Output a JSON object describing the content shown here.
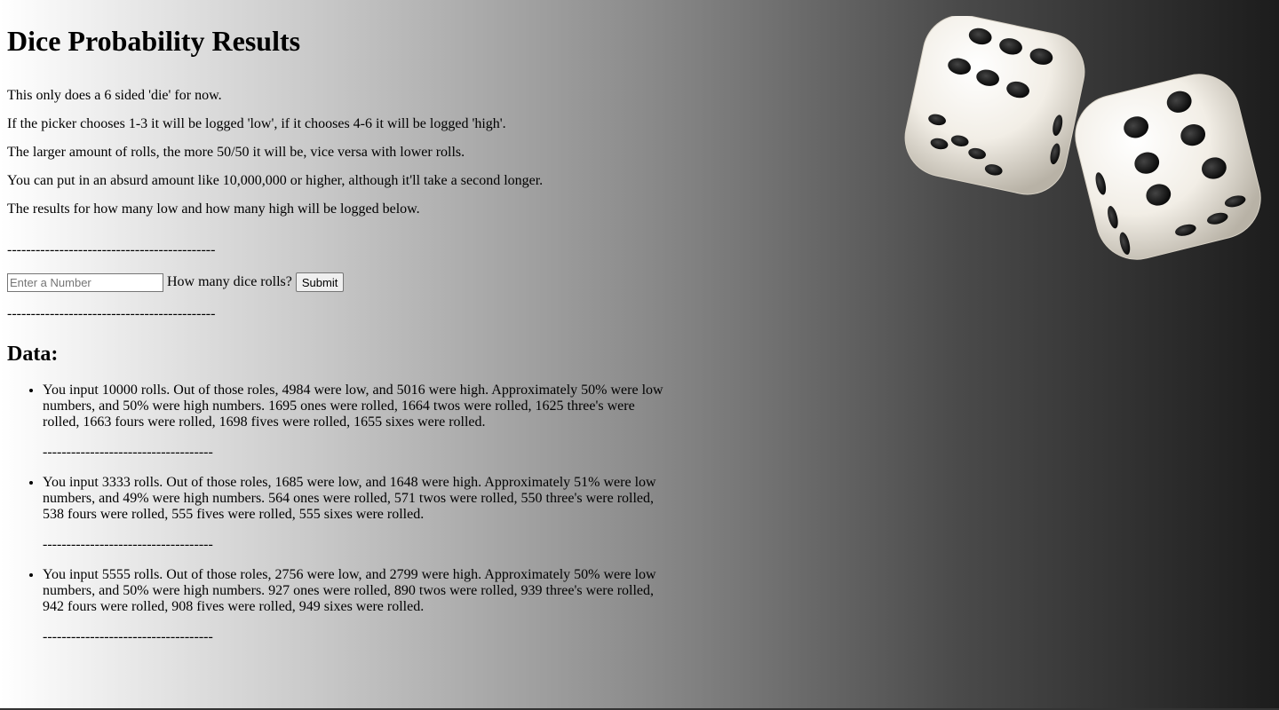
{
  "page": {
    "title": "Dice Probability Results"
  },
  "intro": [
    "This only does a 6 sided 'die' for now.",
    "If the picker chooses 1-3 it will be logged 'low', if it chooses 4-6 it will be logged 'high'.",
    "The larger amount of rolls, the more 50/50 it will be, vice versa with lower rolls.",
    "You can put in an absurd amount like 10,000,000 or higher, although it'll take a second longer.",
    "The results for how many low and how many high will be logged below."
  ],
  "divider_long": "--------------------------------------------",
  "form": {
    "input_placeholder": "Enter a Number",
    "input_value": "",
    "label": "How many dice rolls?",
    "submit_label": "Submit"
  },
  "data_heading": "Data:",
  "results": [
    {
      "text": "You input 10000 rolls. Out of those roles, 4984 were low, and 5016 were high. Approximately 50% were low numbers, and 50% were high numbers. 1695 ones were rolled, 1664 twos were rolled, 1625 three's were rolled, 1663 fours were rolled, 1698 fives were rolled, 1655 sixes were rolled.",
      "divider": "------------------------------------"
    },
    {
      "text": "You input 3333 rolls. Out of those roles, 1685 were low, and 1648 were high. Approximately 51% were low numbers, and 49% were high numbers. 564 ones were rolled, 571 twos were rolled, 550 three's were rolled, 538 fours were rolled, 555 fives were rolled, 555 sixes were rolled.",
      "divider": "------------------------------------"
    },
    {
      "text": "You input 5555 rolls. Out of those roles, 2756 were low, and 2799 were high. Approximately 50% were low numbers, and 50% were high numbers. 927 ones were rolled, 890 twos were rolled, 939 three's were rolled, 942 fours were rolled, 908 fives were rolled, 949 sixes were rolled.",
      "divider": "------------------------------------"
    }
  ],
  "image": {
    "icon": "dice-icon",
    "die_color": "#f2eee6",
    "pip_color": "#111111"
  }
}
